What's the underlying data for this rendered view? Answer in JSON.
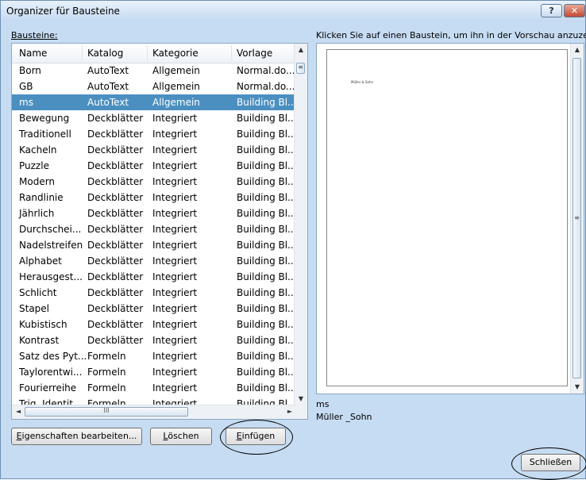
{
  "window": {
    "title": "Organizer für Bausteine",
    "help_glyph": "?",
    "close_glyph": "✕"
  },
  "labels": {
    "bausteine": "Bausteine:",
    "hint": "Klicken Sie auf einen Baustein, um ihn in der Vorschau anzuzeigen."
  },
  "table": {
    "columns": [
      "Name",
      "Katalog",
      "Kategorie",
      "Vorlage"
    ],
    "rows": [
      [
        "Born",
        "AutoText",
        "Allgemein",
        "Normal.do..."
      ],
      [
        "GB",
        "AutoText",
        "Allgemein",
        "Normal.do..."
      ],
      [
        "ms",
        "AutoText",
        "Allgemein",
        "Building Bl..."
      ],
      [
        "Bewegung",
        "Deckblätter",
        "Integriert",
        "Building Bl..."
      ],
      [
        "Traditionell",
        "Deckblätter",
        "Integriert",
        "Building Bl..."
      ],
      [
        "Kacheln",
        "Deckblätter",
        "Integriert",
        "Building Bl..."
      ],
      [
        "Puzzle",
        "Deckblätter",
        "Integriert",
        "Building Bl..."
      ],
      [
        "Modern",
        "Deckblätter",
        "Integriert",
        "Building Bl..."
      ],
      [
        "Randlinie",
        "Deckblätter",
        "Integriert",
        "Building Bl..."
      ],
      [
        "Jährlich",
        "Deckblätter",
        "Integriert",
        "Building Bl..."
      ],
      [
        "Durchschei...",
        "Deckblätter",
        "Integriert",
        "Building Bl..."
      ],
      [
        "Nadelstreifen",
        "Deckblätter",
        "Integriert",
        "Building Bl..."
      ],
      [
        "Alphabet",
        "Deckblätter",
        "Integriert",
        "Building Bl..."
      ],
      [
        "Herausgest...",
        "Deckblätter",
        "Integriert",
        "Building Bl..."
      ],
      [
        "Schlicht",
        "Deckblätter",
        "Integriert",
        "Building Bl..."
      ],
      [
        "Stapel",
        "Deckblätter",
        "Integriert",
        "Building Bl..."
      ],
      [
        "Kubistisch",
        "Deckblätter",
        "Integriert",
        "Building Bl..."
      ],
      [
        "Kontrast",
        "Deckblätter",
        "Integriert",
        "Building Bl..."
      ],
      [
        "Satz des Pyt...",
        "Formeln",
        "Integriert",
        "Building Bl..."
      ],
      [
        "Taylorentwi...",
        "Formeln",
        "Integriert",
        "Building Bl..."
      ],
      [
        "Fourierreihe",
        "Formeln",
        "Integriert",
        "Building Bl..."
      ],
      [
        "Trig. Identit...",
        "Formeln",
        "Integriert",
        "Building Bl..."
      ]
    ],
    "selected_name": "ms"
  },
  "preview": {
    "page_text": "Müller & Sohn",
    "name": "ms",
    "description": "Müller _Sohn"
  },
  "buttons": {
    "eigenschaften": {
      "key": "E",
      "rest": "igenschaften bearbeiten..."
    },
    "loeschen": {
      "key": "L",
      "rest": "öschen"
    },
    "einfuegen": {
      "key": "E",
      "rest": "infügen"
    },
    "schliessen": "Schließen"
  },
  "scroll_glyphs": {
    "up": "▲",
    "down": "▼",
    "left": "◄",
    "right": "►",
    "grip_v": "≡",
    "grip_h": "III"
  },
  "colors": {
    "selection": "#4b8fc0",
    "dialog_bg": "#c6dcf2",
    "title_bar": "#c4daf1"
  }
}
